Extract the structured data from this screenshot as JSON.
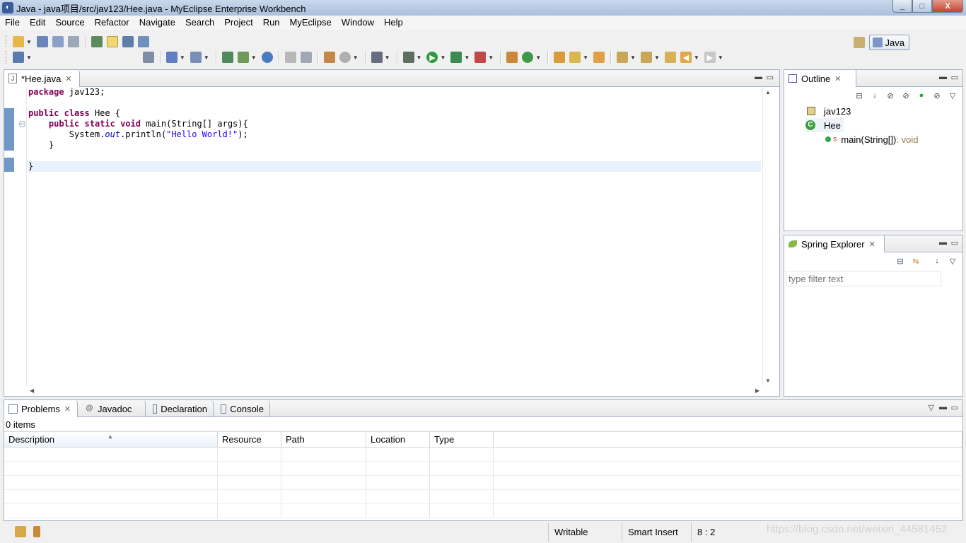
{
  "window": {
    "title": "Java - java项目/src/jav123/Hee.java - MyEclipse Enterprise Workbench",
    "minimize_glyph": "_",
    "maximize_glyph": "□",
    "close_glyph": "X"
  },
  "menu": [
    "File",
    "Edit",
    "Source",
    "Refactor",
    "Navigate",
    "Search",
    "Project",
    "Run",
    "MyEclipse",
    "Window",
    "Help"
  ],
  "perspective": {
    "label": "Java"
  },
  "editor": {
    "tab_label": "*Hee.java",
    "lines": [
      {
        "parts": [
          [
            "kw",
            "package"
          ],
          [
            "",
            " jav123;"
          ]
        ]
      },
      {
        "parts": []
      },
      {
        "parts": [
          [
            "kw",
            "public"
          ],
          [
            "",
            " "
          ],
          [
            "kw",
            "class"
          ],
          [
            "",
            " Hee {"
          ]
        ]
      },
      {
        "parts": [
          [
            "",
            "    "
          ],
          [
            "kw",
            "public"
          ],
          [
            "",
            " "
          ],
          [
            "kw",
            "static"
          ],
          [
            "",
            " "
          ],
          [
            "kw",
            "void"
          ],
          [
            "",
            " main(String[] args){"
          ]
        ]
      },
      {
        "parts": [
          [
            "",
            "        System."
          ],
          [
            "fld",
            "out"
          ],
          [
            "",
            ".println("
          ],
          [
            "str",
            "\"Hello World!\""
          ],
          [
            "",
            ");"
          ]
        ]
      },
      {
        "parts": [
          [
            "",
            "    }"
          ]
        ]
      },
      {
        "parts": []
      },
      {
        "parts": [
          [
            "",
            "}"
          ]
        ]
      }
    ]
  },
  "outline": {
    "tab_label": "Outline",
    "package_name": "jav123",
    "class_name": "Hee",
    "method_name": "main(String[])",
    "method_modifier": "S",
    "method_return": " : void"
  },
  "spring": {
    "tab_label": "Spring Explorer",
    "filter_placeholder": "type filter text"
  },
  "problems": {
    "tabs": [
      "Problems",
      "Javadoc",
      "Declaration",
      "Console"
    ],
    "tab_icons": [
      "problems-icon",
      "javadoc-icon",
      "declaration-icon",
      "console-icon"
    ],
    "javadoc_glyph": "@",
    "items_count": "0 items",
    "columns": [
      "Description",
      "Resource",
      "Path",
      "Location",
      "Type"
    ]
  },
  "status": {
    "writable": "Writable",
    "insert_mode": "Smart Insert",
    "cursor_position": "8 : 2"
  },
  "watermark": "https://blog.csdn.net/weixin_44581452",
  "colors": {
    "keyword": "#7f0055",
    "string": "#2a00ff",
    "field": "#0000c0",
    "ruler_change": "#6f98c8",
    "current_line": "#e8f2fe"
  }
}
